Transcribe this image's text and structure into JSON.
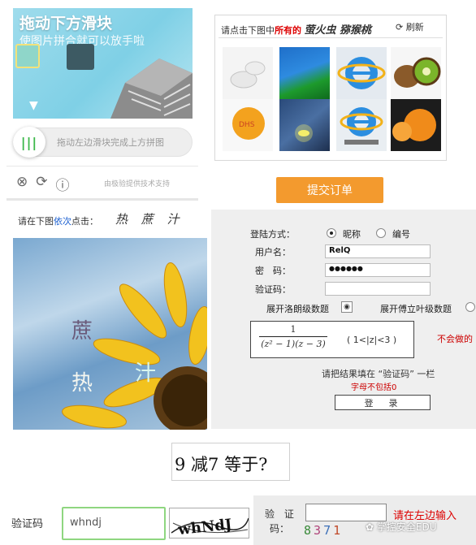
{
  "slider_captcha": {
    "title": "拖动下方滑块",
    "subtitle": "使图片拼合就可以放手啦",
    "hint": "拖动左边滑块完成上方拼图",
    "knob_label": "|||",
    "brand": "由极验提供技术支持",
    "icons": [
      "close-circle-icon",
      "refresh-icon",
      "info-icon"
    ],
    "accent": "#3cb84a"
  },
  "image_grid_captcha": {
    "prompt_before": "请点击下图中",
    "prompt_emph": "所有的",
    "prompt_targets": "萤火虫 猕猴桃",
    "refresh_label": "刷新",
    "submit_label": "提交订单",
    "tiles": [
      "pacifier",
      "grass",
      "ie-logo",
      "kiwi",
      "ping-pong-ball",
      "firefly",
      "ie-logo",
      "orange-ball"
    ],
    "accent": "#f39a2e"
  },
  "click_captcha": {
    "prompt_before": "请在下图",
    "prompt_blue": "依次",
    "prompt_after": "点击：",
    "sequence": "热 蔗 汁",
    "chars": [
      "蔗",
      "热",
      "汁"
    ]
  },
  "login_form": {
    "login_method_label": "登陆方式：",
    "option_nickname": "昵称",
    "option_id": "编号",
    "username_label": "用户名：",
    "username_value": "RelQ",
    "password_label": "密　码：",
    "password_value": "●●●●●●",
    "captcha_label": "验证码：",
    "captcha_value": "",
    "expand_left": "展开洛朗级数题",
    "expand_right": "展开傅立叶级数题",
    "formula_num": "1",
    "formula_den": "(z² − 1)(z − 3)",
    "formula_cond": "( 1<|z|<3 )",
    "warning": "不会做的",
    "fill_hint": "请把结果填在 “验证码” 一栏",
    "note": "字母不包括0",
    "login_button": "登　录"
  },
  "math_captcha": {
    "text": "9 减7 等于?"
  },
  "text_captcha": {
    "label": "验证码",
    "input_value": "whndj",
    "image_text": "whNdJ"
  },
  "digit_captcha": {
    "label_line1": "验 证",
    "label_line2": "码：",
    "digits": [
      "8",
      "3",
      "7",
      "1"
    ],
    "digit_colors": [
      "#3a8a3a",
      "#b0457a",
      "#3c6fb8",
      "#c04a2a"
    ],
    "instruction": "请在左边输入",
    "watermark": "掌控安全EDU"
  }
}
